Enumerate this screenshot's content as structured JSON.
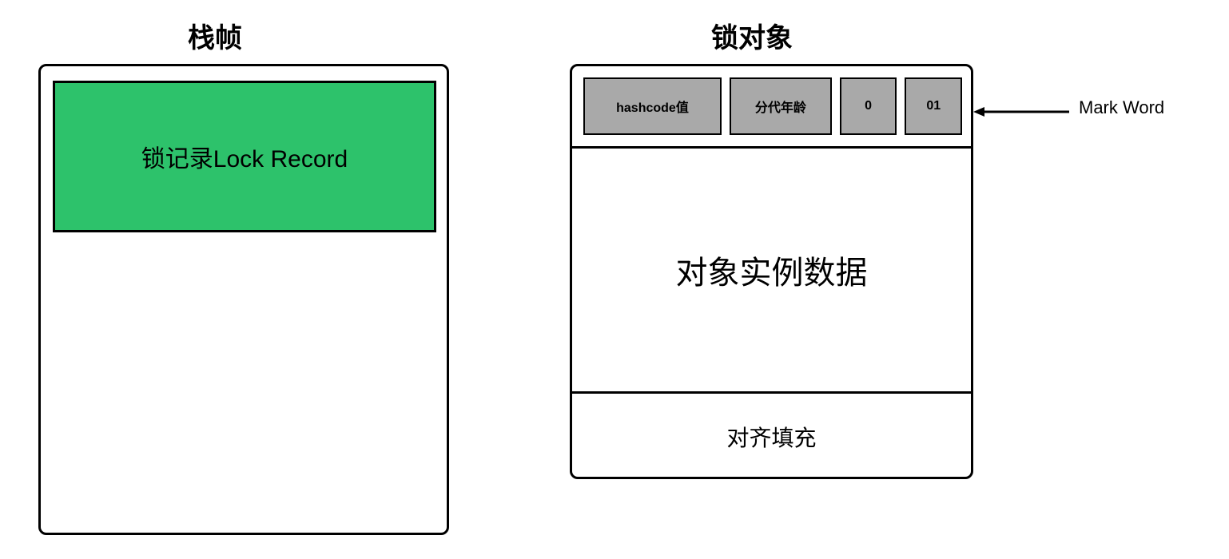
{
  "titles": {
    "stackFrame": "栈帧",
    "lockObject": "锁对象"
  },
  "stackFrame": {
    "lockRecordLabel": "锁记录Lock Record"
  },
  "lockObject": {
    "markWord": {
      "hashcode": "hashcode值",
      "age": "分代年龄",
      "biasFlag": "0",
      "lockFlag": "01"
    },
    "instanceData": "对象实例数据",
    "padding": "对齐填充"
  },
  "annotation": {
    "markWordLabel": "Mark Word"
  }
}
